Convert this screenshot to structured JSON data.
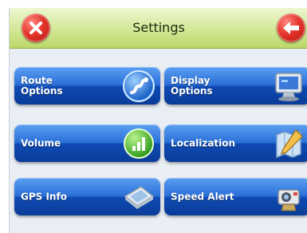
{
  "header": {
    "title": "Settings",
    "close_icon": "close-icon",
    "back_icon": "back-arrow-icon"
  },
  "tiles": [
    {
      "label": "Route\nOptions",
      "icon": "route-icon"
    },
    {
      "label": "Display\nOptions",
      "icon": "monitor-icon"
    },
    {
      "label": "Volume",
      "icon": "volume-icon"
    },
    {
      "label": "Localization",
      "icon": "map-pen-icon"
    },
    {
      "label": "GPS Info",
      "icon": "gps-device-icon"
    },
    {
      "label": "Speed Alert",
      "icon": "speed-camera-icon"
    }
  ],
  "colors": {
    "header_green": "#c5de7a",
    "tile_blue": "#2a6fd6",
    "close_red": "#e3332a"
  }
}
